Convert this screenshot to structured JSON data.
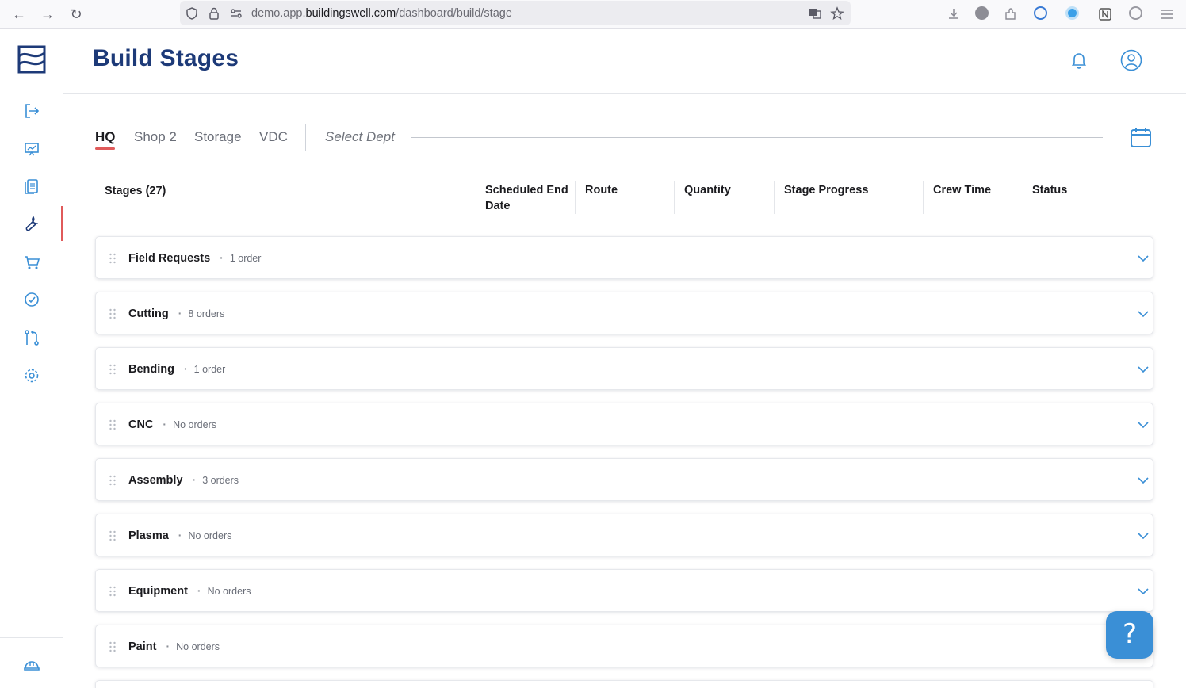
{
  "browser": {
    "url_prefix": "demo.app.",
    "url_host": "buildingswell.com",
    "url_path": "/dashboard/build/stage",
    "back": "←",
    "forward": "→",
    "reload": "↻"
  },
  "header": {
    "title": "Build Stages"
  },
  "tabs": [
    {
      "label": "HQ",
      "active": true
    },
    {
      "label": "Shop 2",
      "active": false
    },
    {
      "label": "Storage",
      "active": false
    },
    {
      "label": "VDC",
      "active": false
    }
  ],
  "dept_select": {
    "placeholder": "Select Dept"
  },
  "table": {
    "columns": [
      {
        "label": "Stages (27)"
      },
      {
        "label": "Scheduled End Date"
      },
      {
        "label": "Route"
      },
      {
        "label": "Quantity"
      },
      {
        "label": "Stage Progress"
      },
      {
        "label": "Crew Time"
      },
      {
        "label": "Status"
      }
    ]
  },
  "stages": [
    {
      "name": "Field Requests",
      "count": "1 order"
    },
    {
      "name": "Cutting",
      "count": "8 orders"
    },
    {
      "name": "Bending",
      "count": "1 order"
    },
    {
      "name": "CNC",
      "count": "No orders"
    },
    {
      "name": "Assembly",
      "count": "3 orders"
    },
    {
      "name": "Plasma",
      "count": "No orders"
    },
    {
      "name": "Equipment",
      "count": "No orders"
    },
    {
      "name": "Paint",
      "count": "No orders"
    }
  ],
  "help": {
    "label": "?"
  },
  "colors": {
    "brand": "#1d3a78",
    "accent": "#e05a5a",
    "icon": "#3a8fd6"
  }
}
